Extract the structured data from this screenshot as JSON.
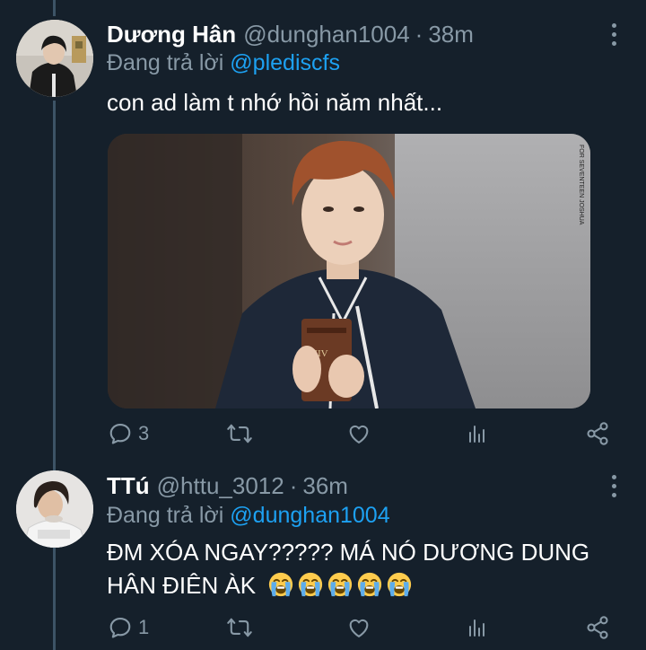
{
  "tweets": [
    {
      "display_name": "Dương Hân",
      "handle": "@dunghan1004",
      "separator": "·",
      "time": "38m",
      "reply_prefix": "Đang trả lời",
      "reply_to": "@plediscfs",
      "text": "con ad làm t nhớ hồi năm nhất...",
      "media_watermark": "FOR SEVENTEEN JOSHUA",
      "media_bible_label": "NIV",
      "counts": {
        "reply": "3",
        "retweet": "",
        "like": ""
      }
    },
    {
      "display_name": "TTú",
      "handle": "@httu_3012",
      "separator": "·",
      "time": "36m",
      "reply_prefix": "Đang trả lời",
      "reply_to": "@dunghan1004",
      "text_line1": "ĐM XÓA NGAY????? MÁ NÓ DƯƠNG DUNG",
      "text_line2": "HÂN ĐIÊN ÀK",
      "emoji": "loudly-crying-face",
      "emoji_count": 5,
      "counts": {
        "reply": "1",
        "retweet": "",
        "like": ""
      }
    }
  ],
  "colors": {
    "background": "#15202b",
    "secondary_text": "#8899a6",
    "link": "#1da1f2",
    "thread_line": "#3d5466"
  },
  "icons": [
    "reply-icon",
    "retweet-icon",
    "like-icon",
    "analytics-icon",
    "share-icon",
    "more-icon"
  ]
}
